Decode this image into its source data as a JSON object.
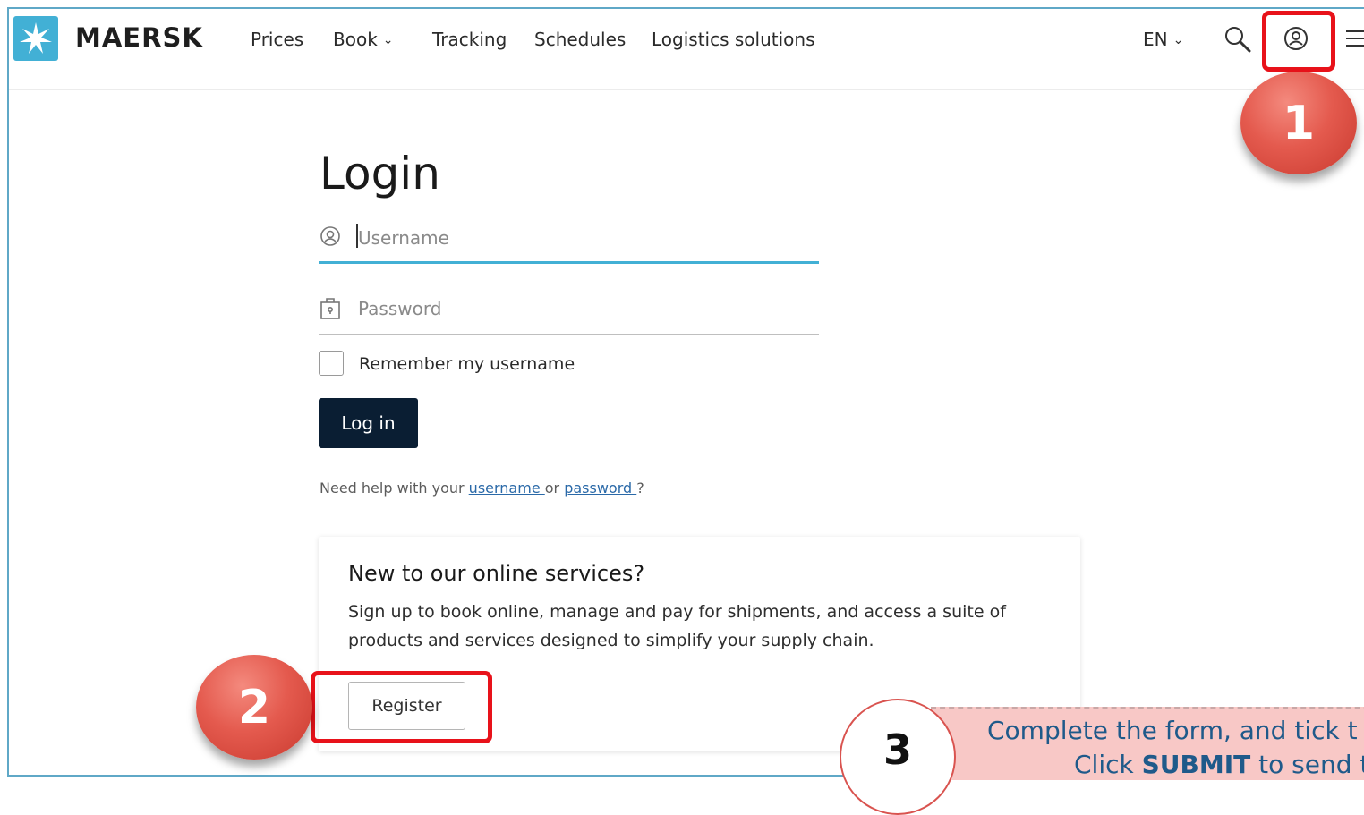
{
  "brand": "MAERSK",
  "nav": {
    "prices": "Prices",
    "book": "Book",
    "tracking": "Tracking",
    "schedules": "Schedules",
    "logistics": "Logistics solutions",
    "language": "EN"
  },
  "login": {
    "title": "Login",
    "username_placeholder": "Username",
    "password_placeholder": "Password",
    "remember_label": "Remember my username",
    "login_button": "Log in",
    "help_prefix": "Need help with your ",
    "help_username": "username ",
    "help_or": "or ",
    "help_password": "password ",
    "help_suffix": "?"
  },
  "card": {
    "title": "New to our online services?",
    "text": "Sign up to book online, manage and pay for shipments, and access a suite of products and services designed to simplify your supply chain.",
    "register_button": "Register"
  },
  "annotations": {
    "step1": "1",
    "step2": "2",
    "step3": "3",
    "callout_line1": "Complete the form, and tick t",
    "callout_line2_prefix": "Click ",
    "callout_line2_bold": "SUBMIT",
    "callout_line2_suffix": " to send th",
    "highlight_color": "#e8121a",
    "accent_color": "#42b0d5"
  }
}
